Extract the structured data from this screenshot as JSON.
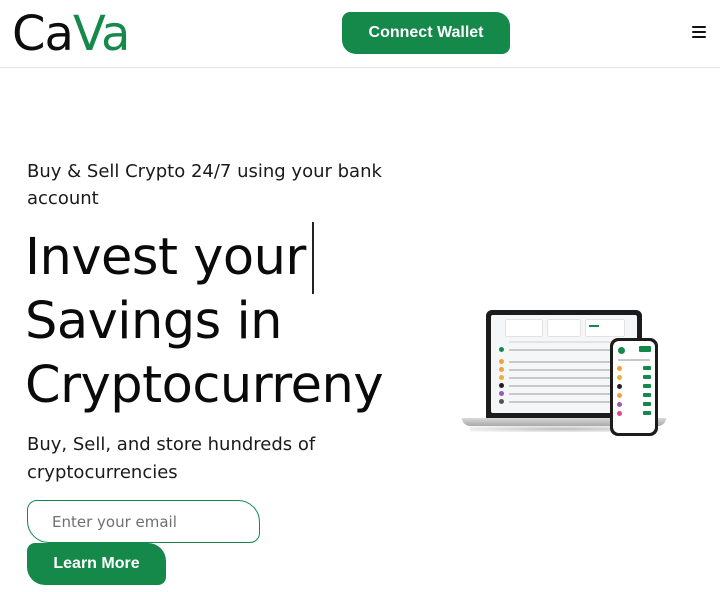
{
  "header": {
    "logo_part1": "Ca",
    "logo_part2": "Va",
    "connect_label": "Connect Wallet",
    "menu_icon": "hamburger-menu-icon"
  },
  "hero": {
    "tagline": "Buy & Sell Crypto 24/7 using your bank account",
    "headline_line1": "Invest your",
    "headline_line2": "Savings in",
    "headline_line3": "Cryptocurreny",
    "subline": "Buy, Sell, and store hundreds of cryptocurrencies",
    "email_placeholder": "Enter your email",
    "learn_more_label": "Learn More"
  },
  "colors": {
    "brand_green": "#14894a",
    "text_dark": "#0a0a0a"
  },
  "mockup": {
    "icon": "laptop-and-phone-illustration"
  }
}
